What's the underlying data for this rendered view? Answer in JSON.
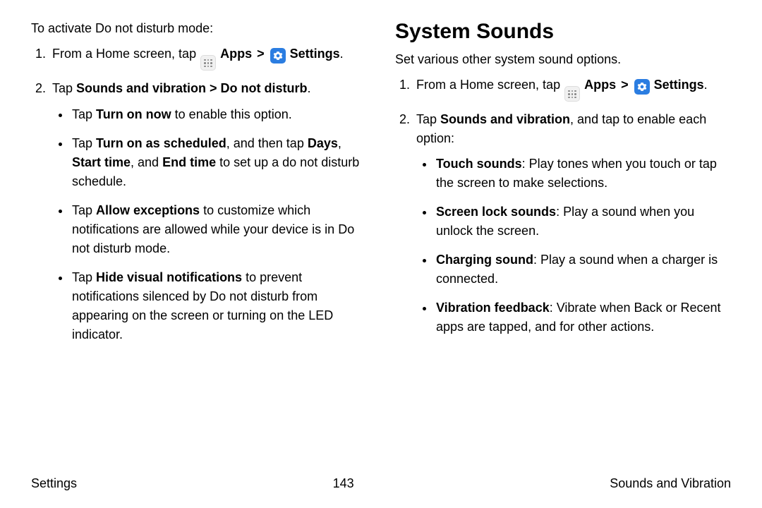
{
  "left": {
    "intro": "To activate Do not disturb mode:",
    "step1_pre": "From a Home screen, tap ",
    "apps_label": "Apps",
    "chev": ">",
    "settings_label": "Settings",
    "period": ".",
    "step2_pre": "Tap ",
    "step2_bold": "Sounds and vibration > Do not disturb",
    "bullets": [
      {
        "pre": "Tap ",
        "b1": "Turn on now",
        "post": " to enable this option."
      },
      {
        "pre": "Tap ",
        "b1": "Turn on as scheduled",
        "mid1": ", and then tap ",
        "b2": "Days",
        "mid2": ", ",
        "b3": "Start time",
        "mid3": ", and ",
        "b4": "End time",
        "post": " to set up a do not disturb schedule."
      },
      {
        "pre": "Tap ",
        "b1": "Allow exceptions",
        "post": " to customize which notifications are allowed while your device is in Do not disturb mode."
      },
      {
        "pre": "Tap ",
        "b1": "Hide visual notifications",
        "post": " to prevent notifications silenced by Do not disturb from appearing on the screen or turning on the LED indicator."
      }
    ]
  },
  "right": {
    "heading": "System Sounds",
    "intro": "Set various other system sound options.",
    "step1_pre": "From a Home screen, tap ",
    "apps_label": "Apps",
    "chev": ">",
    "settings_label": "Settings",
    "period": ".",
    "step2_pre": "Tap ",
    "step2_bold": "Sounds and vibration",
    "step2_post": ", and tap to enable each option:",
    "bullets": [
      {
        "b1": "Touch sounds",
        "post": ": Play tones when you touch or tap the screen to make selections."
      },
      {
        "b1": "Screen lock sounds",
        "post": ": Play a sound when you unlock the screen."
      },
      {
        "b1": "Charging sound",
        "post": ": Play a sound when a charger is connected."
      },
      {
        "b1": "Vibration feedback",
        "post": ": Vibrate when Back or Recent apps are tapped, and for other actions."
      }
    ]
  },
  "footer": {
    "left": "Settings",
    "center": "143",
    "right": "Sounds and Vibration"
  }
}
